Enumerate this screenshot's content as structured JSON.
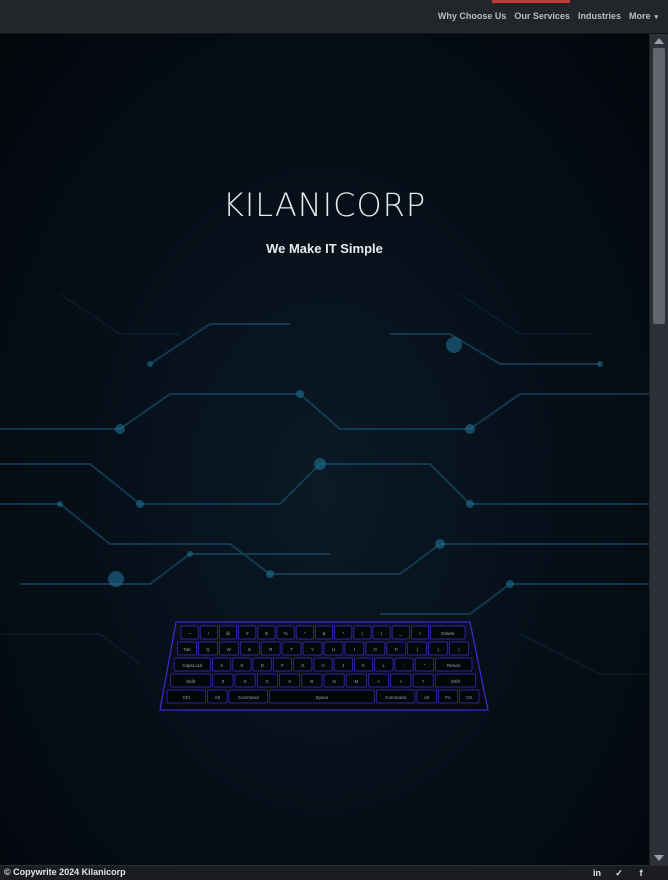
{
  "nav": {
    "items": [
      "Why Choose Us",
      "Our Services",
      "Industries",
      "More"
    ],
    "more_caret": "▾"
  },
  "hero": {
    "logo": "KILANICORP",
    "tagline": "We Make IT Simple"
  },
  "keyboard": {
    "rows": [
      [
        "~",
        "!",
        "@",
        "#",
        "$",
        "%",
        "^",
        "&",
        "*",
        "(",
        ")",
        "_",
        "+",
        "Delete"
      ],
      [
        "Tab",
        "Q",
        "W",
        "E",
        "R",
        "T",
        "Y",
        "U",
        "I",
        "O",
        "P",
        "{",
        "}",
        "|"
      ],
      [
        "CapsLock",
        "A",
        "S",
        "D",
        "F",
        "G",
        "H",
        "J",
        "K",
        "L",
        ":",
        "\"",
        "Return"
      ],
      [
        "Shift",
        "Z",
        "X",
        "C",
        "V",
        "B",
        "N",
        "M",
        "<",
        ">",
        "?",
        "Shift"
      ],
      [
        "Ctrl",
        "Alt",
        "Command",
        "Space",
        "Command",
        "Alt",
        "Fn",
        "Ctr"
      ]
    ]
  },
  "footer": {
    "copyright": "© Copywrite 2024 Kilanicorp",
    "social": [
      {
        "icon": "linkedin-icon",
        "glyph": "in"
      },
      {
        "icon": "twitter-icon",
        "glyph": "✓"
      },
      {
        "icon": "facebook-icon",
        "glyph": "f"
      }
    ]
  },
  "colors": {
    "background": "#05080d",
    "topbar": "#22252a",
    "accent": "#c23a3a",
    "circuit": "#1c5a78",
    "keyboard_glow": "#3a2bd6"
  }
}
